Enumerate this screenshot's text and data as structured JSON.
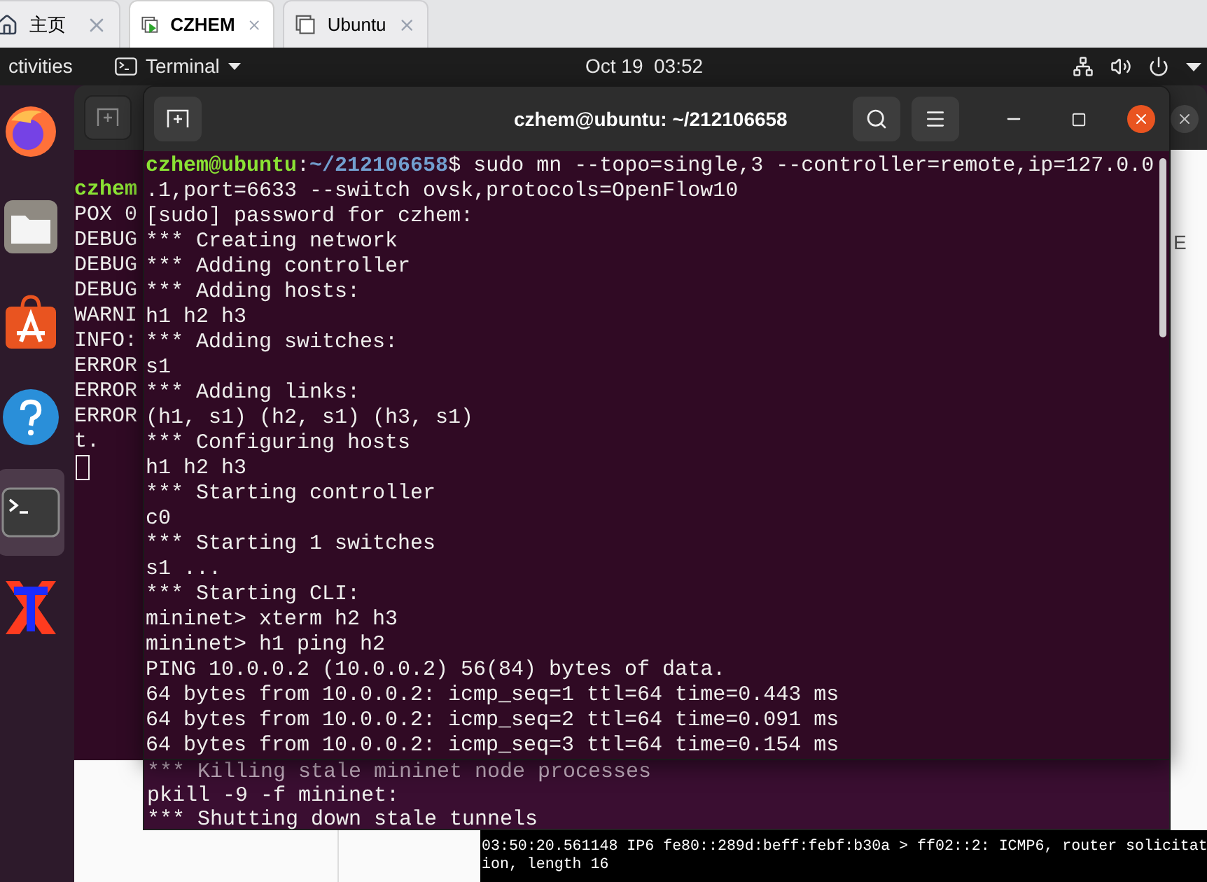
{
  "browser_tabs": [
    {
      "label": "主页",
      "kind": "home",
      "selected": false
    },
    {
      "label": "CZHEM",
      "kind": "vm-running",
      "selected": true
    },
    {
      "label": "Ubuntu",
      "kind": "vm",
      "selected": false
    }
  ],
  "top_bar": {
    "activities": "ctivities",
    "app_menu": "Terminal",
    "clock": "Oct 19  03:52"
  },
  "dock": [
    {
      "kind": "firefox",
      "selected": false
    },
    {
      "kind": "files",
      "selected": false
    },
    {
      "kind": "software",
      "selected": false
    },
    {
      "kind": "help",
      "selected": false
    },
    {
      "kind": "terminal",
      "selected": true
    },
    {
      "kind": "xterm",
      "selected": false
    }
  ],
  "background_window": {
    "text": "E"
  },
  "back_terminal": {
    "lines": [
      {
        "kind": "prompt",
        "text": "czhem"
      },
      {
        "kind": "output",
        "text": "POX 0"
      },
      {
        "kind": "output",
        "text": "DEBUG"
      },
      {
        "kind": "output",
        "text": "DEBUG"
      },
      {
        "kind": "output",
        "text": "DEBUG"
      },
      {
        "kind": "output",
        "text": "WARNI"
      },
      {
        "kind": "output",
        "text": "INFO:"
      },
      {
        "kind": "output",
        "text": "ERROR"
      },
      {
        "kind": "output",
        "text": "ERROR"
      },
      {
        "kind": "output",
        "text": "ERROR"
      },
      {
        "kind": "output",
        "text": "t."
      }
    ]
  },
  "cleanup_terminal": {
    "lines": [
      "*** Killing stale mininet node processes",
      "pkill -9 -f mininet:",
      "*** Shutting down stale tunnels"
    ]
  },
  "xterm": {
    "lines": [
      "03:50:20.561148 IP6 fe80::289d:beff:febf:b30a > ff02::2: ICMP6, router solicitat",
      "ion, length 16"
    ]
  },
  "terminal": {
    "title": "czhem@ubuntu: ~/212106658",
    "lines": [
      {
        "kind": "prompt",
        "user_host": "czhem@ubuntu",
        "separator": ":",
        "path": "~/212106658",
        "text": "$ sudo mn --topo=single,3 --controller=remote,ip=127.0.0"
      },
      {
        "kind": "output",
        "text": ".1,port=6633 --switch ovsk,protocols=OpenFlow10"
      },
      {
        "kind": "output",
        "text": "[sudo] password for czhem:"
      },
      {
        "kind": "output",
        "text": "*** Creating network"
      },
      {
        "kind": "output",
        "text": "*** Adding controller"
      },
      {
        "kind": "output",
        "text": "*** Adding hosts:"
      },
      {
        "kind": "output",
        "text": "h1 h2 h3"
      },
      {
        "kind": "output",
        "text": "*** Adding switches:"
      },
      {
        "kind": "output",
        "text": "s1"
      },
      {
        "kind": "output",
        "text": "*** Adding links:"
      },
      {
        "kind": "output",
        "text": "(h1, s1) (h2, s1) (h3, s1)"
      },
      {
        "kind": "output",
        "text": "*** Configuring hosts"
      },
      {
        "kind": "output",
        "text": "h1 h2 h3"
      },
      {
        "kind": "output",
        "text": "*** Starting controller"
      },
      {
        "kind": "output",
        "text": "c0"
      },
      {
        "kind": "output",
        "text": "*** Starting 1 switches"
      },
      {
        "kind": "output",
        "text": "s1 ..."
      },
      {
        "kind": "output",
        "text": "*** Starting CLI:"
      },
      {
        "kind": "output",
        "text": "mininet> xterm h2 h3"
      },
      {
        "kind": "output",
        "text": "mininet> h1 ping h2"
      },
      {
        "kind": "output",
        "text": "PING 10.0.0.2 (10.0.0.2) 56(84) bytes of data."
      },
      {
        "kind": "output",
        "text": "64 bytes from 10.0.0.2: icmp_seq=1 ttl=64 time=0.443 ms"
      },
      {
        "kind": "output",
        "text": "64 bytes from 10.0.0.2: icmp_seq=2 ttl=64 time=0.091 ms"
      },
      {
        "kind": "output",
        "text": "64 bytes from 10.0.0.2: icmp_seq=3 ttl=64 time=0.154 ms"
      }
    ]
  }
}
